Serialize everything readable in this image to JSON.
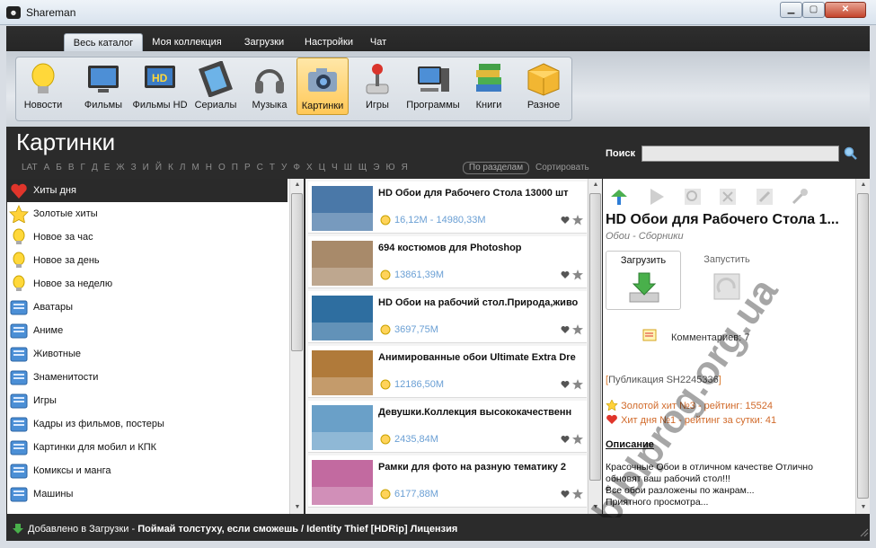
{
  "window": {
    "title": "Shareman",
    "minimize": "▁",
    "maximize": "▢",
    "close": "✕"
  },
  "menu": {
    "tabs": [
      {
        "label": "Весь каталог",
        "active": true
      },
      {
        "label": "Моя коллекция"
      },
      {
        "label": "Загрузки"
      },
      {
        "label": "Настройки"
      },
      {
        "label": "Чат"
      }
    ]
  },
  "categories": [
    {
      "label": "Новости",
      "icon": "lightbulb-icon"
    },
    {
      "label": "Фильмы",
      "icon": "tv-icon"
    },
    {
      "label": "Фильмы HD",
      "icon": "hd-tv-icon"
    },
    {
      "label": "Сериалы",
      "icon": "film-strip-icon"
    },
    {
      "label": "Музыка",
      "icon": "headphones-icon"
    },
    {
      "label": "Картинки",
      "icon": "camera-icon",
      "active": true
    },
    {
      "label": "Игры",
      "icon": "joystick-icon"
    },
    {
      "label": "Программы",
      "icon": "computer-icon"
    },
    {
      "label": "Книги",
      "icon": "books-icon"
    },
    {
      "label": "Разное",
      "icon": "box-icon"
    }
  ],
  "section": {
    "heading": "Картинки",
    "alphabet": [
      "LAT",
      "А",
      "Б",
      "В",
      "Г",
      "Д",
      "Е",
      "Ж",
      "З",
      "И",
      "Й",
      "К",
      "Л",
      "М",
      "Н",
      "О",
      "П",
      "Р",
      "С",
      "Т",
      "У",
      "Ф",
      "Х",
      "Ц",
      "Ч",
      "Ш",
      "Щ",
      "Э",
      "Ю",
      "Я"
    ],
    "by_section_label": "По разделам",
    "sort_label": "Сортировать"
  },
  "search": {
    "label": "Поиск",
    "value": ""
  },
  "left_list": [
    {
      "label": "Хиты дня",
      "icon": "heart-icon",
      "active": true
    },
    {
      "label": "Золотые хиты",
      "icon": "star-icon"
    },
    {
      "label": "Новое за час",
      "icon": "lightbulb-icon"
    },
    {
      "label": "Новое за день",
      "icon": "lightbulb-icon"
    },
    {
      "label": "Новое за неделю",
      "icon": "lightbulb-icon"
    },
    {
      "label": "Аватары",
      "icon": "folder-icon"
    },
    {
      "label": "Аниме",
      "icon": "folder-icon"
    },
    {
      "label": "Животные",
      "icon": "folder-icon"
    },
    {
      "label": "Знаменитости",
      "icon": "folder-icon"
    },
    {
      "label": "Игры",
      "icon": "folder-icon"
    },
    {
      "label": "Кадры из фильмов, постеры",
      "icon": "folder-icon"
    },
    {
      "label": "Картинки для мобил и КПК",
      "icon": "folder-icon"
    },
    {
      "label": "Комиксы и манга",
      "icon": "folder-icon"
    },
    {
      "label": "Машины",
      "icon": "folder-icon"
    }
  ],
  "items": [
    {
      "title": "HD Обои для Рабочего Стола 13000 шт",
      "size": "16,12M - 14980,33M",
      "thumb": "#4a78a8"
    },
    {
      "title": "694 костюмов для Photoshop",
      "size": "13861,39M",
      "thumb": "#a88a6a"
    },
    {
      "title": "HD Обои на рабочий стол.Природа,живо",
      "size": "3697,75M",
      "thumb": "#2e6ea0"
    },
    {
      "title": "Анимированные обои Ultimate Extra Dre",
      "size": "12186,50M",
      "thumb": "#b07a3a"
    },
    {
      "title": "Девушки.Коллекция высококачественн",
      "size": "2435,84M",
      "thumb": "#6aa0c8"
    },
    {
      "title": "Рамки для фото на разную тематику 2",
      "size": "6177,88M",
      "thumb": "#c26aa0"
    }
  ],
  "detail": {
    "title": "HD Обои для Рабочего Стола 1...",
    "subtitle": "Обои - Сборники",
    "download_label": "Загрузить",
    "run_label": "Запустить",
    "comments": "Комментариев: 7",
    "publication_prefix": "[",
    "publication": "Публикация SH2245336",
    "publication_suffix": "]",
    "gold_hit": "Золотой хит №3 - рейтинг: 15524",
    "day_hit": "Хит дня №1 - рейтинг за сутки: 41",
    "description_heading": "Описание",
    "description": "Красочные Обои в отличном качестве Отлично\nобновят ваш рабочий стол!!!\nВсе обои разложены по жанрам...\nПриятного просмотра..."
  },
  "watermark": "biblprog.org.ua",
  "status": {
    "prefix": "Добавлено в Загрузки - ",
    "item": "Поймай толстуху, если сможешь / Identity Thief [HDRip] Лицензия"
  },
  "colors": {
    "frame": "#2b2b2b",
    "accent": "#ffc857",
    "size_text": "#6a9fd4",
    "hit_text": "#d16a2a"
  }
}
